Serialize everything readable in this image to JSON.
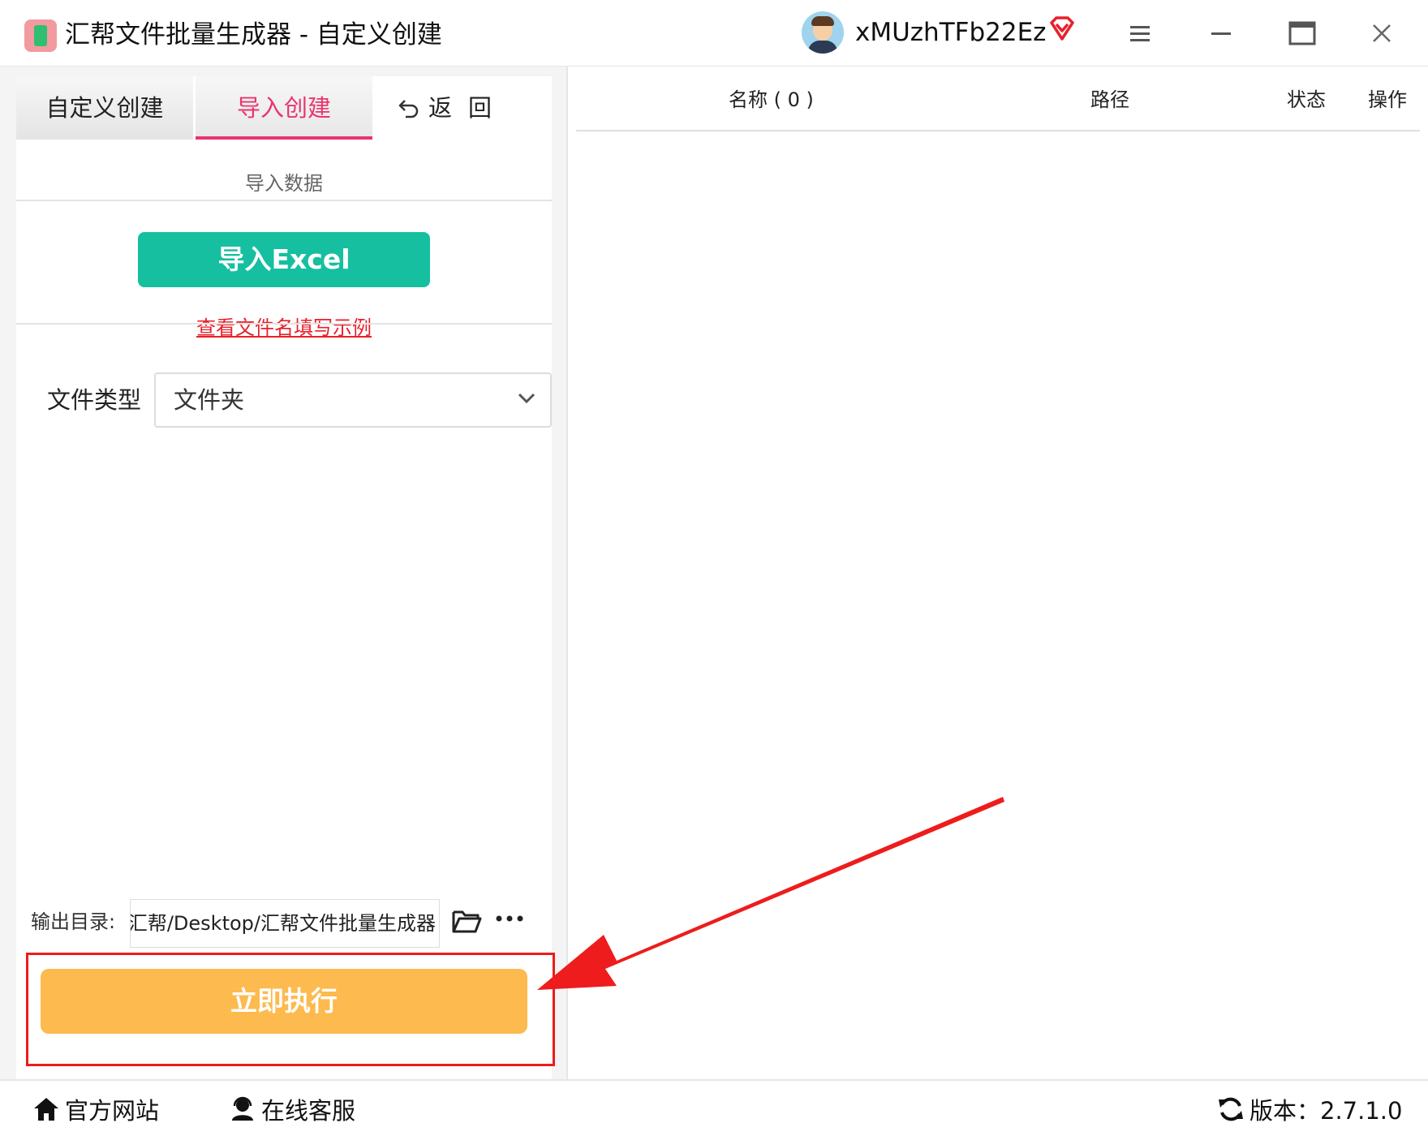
{
  "titlebar": {
    "title": "汇帮文件批量生成器 - 自定义创建",
    "username": "xMUzhTFb22Ez",
    "vip_icon": "vip-diamond-icon",
    "menu_icon": "menu-icon",
    "minimize_icon": "minimize-icon",
    "maximize_icon": "maximize-icon",
    "close_icon": "close-icon",
    "accent_color": "#e8356e"
  },
  "left_panel": {
    "tabs": [
      {
        "label": "自定义创建",
        "active": false
      },
      {
        "label": "导入创建",
        "active": true
      }
    ],
    "back_label": "返回",
    "section_label": "导入数据",
    "import_button": "导入Excel",
    "import_button_color": "#16bfa0",
    "example_link": "查看文件名填写示例",
    "file_type": {
      "label": "文件类型",
      "selected": "文件夹"
    },
    "output": {
      "label": "输出目录:",
      "path": "汇帮/Desktop/汇帮文件批量生成器"
    },
    "run_button": "立即执行",
    "run_button_color": "#fdba4f"
  },
  "table": {
    "columns": [
      "名称 ( 0 )",
      "路径",
      "状态",
      "操作"
    ],
    "rows": []
  },
  "footer": {
    "website": "官方网站",
    "support": "在线客服",
    "version": "版本：2.7.1.0"
  }
}
